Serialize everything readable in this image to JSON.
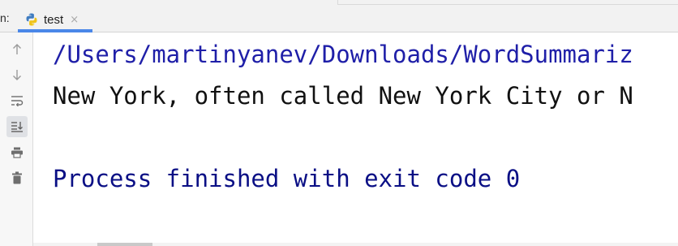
{
  "run_panel": {
    "label": "n:",
    "tab": {
      "title": "test",
      "close_symbol": "×",
      "icon": "python-file-icon"
    }
  },
  "toolbar": {
    "buttons": [
      {
        "name": "up-arrow-icon"
      },
      {
        "name": "down-arrow-icon"
      },
      {
        "name": "soft-wrap-icon"
      },
      {
        "name": "scroll-to-end-icon",
        "active": true
      },
      {
        "name": "print-icon"
      },
      {
        "name": "trash-icon"
      }
    ]
  },
  "console": {
    "path_line": "/Users/martinyanev/Downloads/WordSummariz",
    "output_line": "New York, often called New York City or N",
    "exit_line": "Process finished with exit code 0"
  },
  "colors": {
    "path_text": "#1f1fa8",
    "output_text": "#111111",
    "exit_text": "#0a0f85",
    "tab_accent": "#4a87e8"
  }
}
